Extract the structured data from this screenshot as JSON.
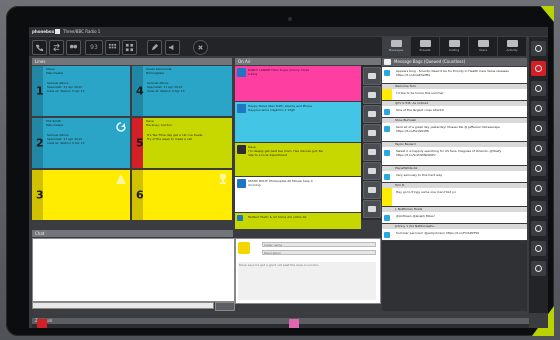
{
  "app": {
    "logo": "phonebox",
    "title": "Three/BBC Radio 1"
  },
  "colors": {
    "yellow": "#ffec00",
    "teal": "#2aa5c8",
    "pink": "#ff3ea2",
    "lime": "#c7d800",
    "red": "#d31f26",
    "cyan": "#43c5e6",
    "blue": "#1f76c2"
  },
  "toolbar": {
    "counter": "93"
  },
  "lines": {
    "header": "Lines",
    "items": [
      {
        "number": "1",
        "caller": "Steve",
        "location": "Manchester",
        "detail": "Samuel Atkins\nSpecialist: 17 Apr 2013\nCalls at: Station 3 Apr 13"
      },
      {
        "number": "4",
        "caller": "Sarah Simmonds",
        "location": "Birmingham",
        "detail": "Samuel Atkins\nSpecialist: 17 Apr 2013\nCalls at: Station 3 Apr 13"
      },
      {
        "number": "2",
        "caller": "Phil Smith",
        "location": "Manchester",
        "detail": "Samuel Atkins\nSpecialist: 17 Apr 2013\nCalls at: Station 3 Apr 13"
      },
      {
        "number": "5",
        "caller": "Dave",
        "location": "Hackney, London",
        "detail": "It's Tea Time day get a cat coe treats\nTry of the week to make a call"
      },
      {
        "number": "3",
        "caller": "",
        "location": "",
        "detail": ""
      },
      {
        "number": "6",
        "caller": "",
        "location": "",
        "detail": ""
      }
    ]
  },
  "on_air": {
    "header": "On Air",
    "messages": [
      {
        "text": "RANDY LANNIE Hello Super Johnny Amaz\nLuting",
        "time": "17:38"
      },
      {
        "text": "Happy Steve likes Trafic Liberty and Phone\nHeyyourname 14g2mm 1 13g5",
        "time": "17:32"
      },
      {
        "text": "Dave\nI'm deeply get past tea mom. Hes discuss gut. Be\nlate to a local department",
        "time": "17:31"
      },
      {
        "text": "STATIC ROUT: Philosophie 20 Mouse Carp 4\nmorning",
        "time": "17:29"
      },
      {
        "text": "Twitter! Fastic & lot home Am smtrs bit",
        "time": "17:25"
      }
    ]
  },
  "chat": {
    "header": "Chat"
  },
  "phone": {
    "caller_name_placeholder": "Caller name",
    "description_placeholder": "Description",
    "body": "Dave says he got a good cat past the area in London"
  },
  "tabs": [
    {
      "label": "Messages"
    },
    {
      "label": "Presets"
    },
    {
      "label": "Calling"
    },
    {
      "label": "Users"
    },
    {
      "label": "Activity"
    }
  ],
  "queue": {
    "header": "Message Bags (Queued (Countless)",
    "items": [
      {
        "head": "Appears blog",
        "text": "Appears blog - Scientic Need it be for Priority in Health Care Value\nreleases https://t.co/bxeKhxMfa"
      },
      {
        "head": "Welcome Tom",
        "text": "I'd like to be home this summer"
      },
      {
        "head": "@T.I.S.Tr.B. As noticed",
        "text": "One of the largest cross Atlantic"
      },
      {
        "head": "Shoe Burtuaki",
        "text": "Sent all of a great day yesterday! Musser Pei @ Jefferson Norsescape\nhttps://t.co/Ee1Gtlxtfk"
      },
      {
        "head": "Taylor Benard",
        "text": "Sweet 2 is happily searching for US fans. Disguise of Orlando. @thiefy\nhttps://t.co/ScZ3WNC60Pv"
      },
      {
        "head": "PlanetWilda bk",
        "text": "Very seriously to this hard way"
      },
      {
        "head": "Tom R.",
        "text": "Hey go to fringy some one man Hold jor"
      },
      {
        "head": "J. Notthman Holds",
        "text": "@Antheen @anaph Miles!"
      },
      {
        "head": "Johnny 1 (S1 Natitoniephu",
        "text": "Summer percular! @jackjohnson https://t.co/FO12NT50"
      }
    ]
  },
  "bottom": {
    "header": "Zentrum"
  }
}
